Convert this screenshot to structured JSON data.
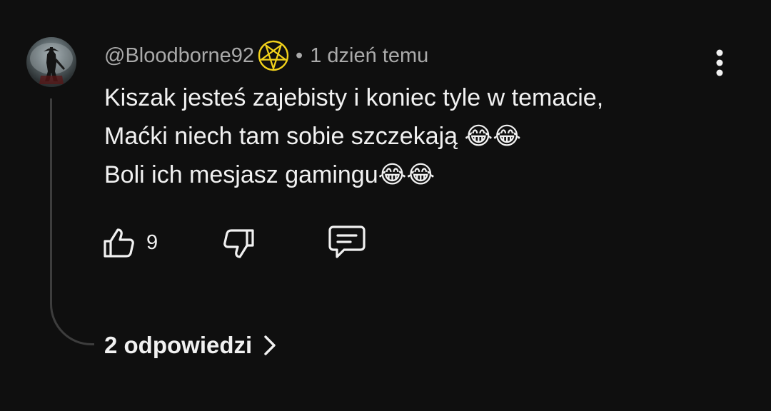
{
  "comment": {
    "avatar_icon": "bloodborne-hunter-avatar",
    "username": "@Bloodborne92",
    "badge_icon": "pentagram-icon",
    "badge_color": "#f2d21b",
    "separator": "•",
    "timestamp": "1 dzień temu",
    "lines": [
      "Kiszak jesteś zajebisty i koniec tyle w temacie,",
      "Maćki niech tam sobie szczekają 😂😂",
      "Boli ich mesjasz gamingu😂😂"
    ],
    "like_count": "9",
    "replies_label": "2 odpowiedzi"
  }
}
